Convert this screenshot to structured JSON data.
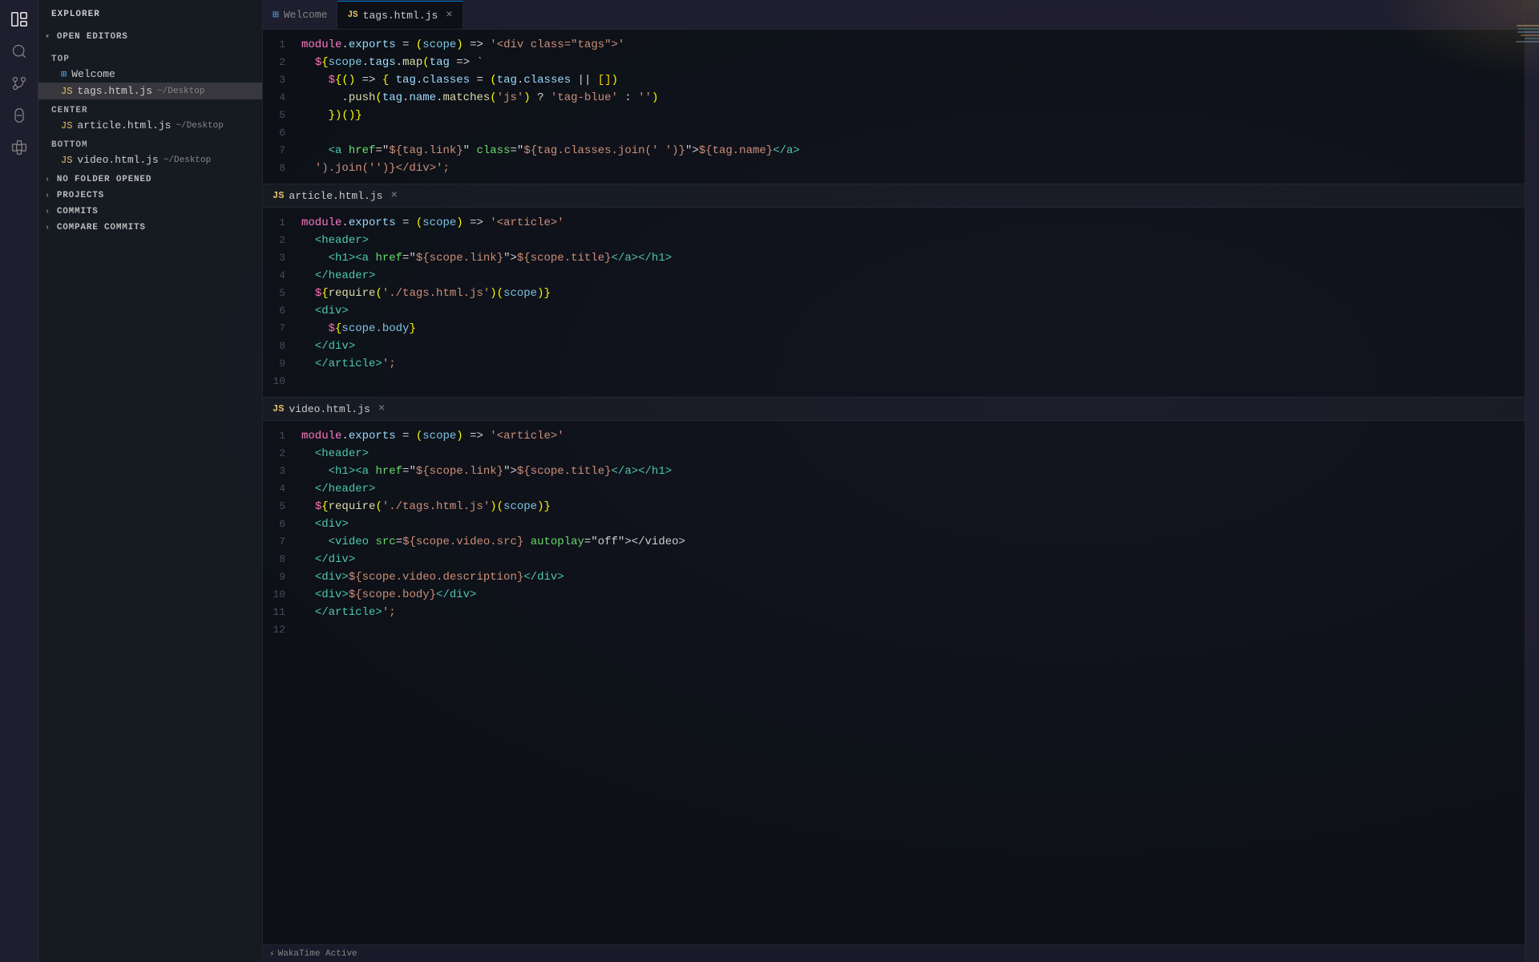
{
  "sidebar": {
    "title": "EXPLORER",
    "sections": {
      "open_editors": {
        "label": "OPEN EDITORS",
        "top_label": "TOP",
        "center_label": "CENTER",
        "bottom_label": "BOTTOM",
        "top_files": [
          {
            "name": "Welcome",
            "type": "welcome",
            "path": ""
          },
          {
            "name": "tags.html.js",
            "type": "js",
            "path": "~/Desktop",
            "active": true
          }
        ],
        "center_files": [
          {
            "name": "article.html.js",
            "type": "js",
            "path": "~/Desktop"
          }
        ],
        "bottom_files": [
          {
            "name": "video.html.js",
            "type": "js",
            "path": "~/Desktop"
          }
        ]
      },
      "no_folder": "NO FOLDER OPENED",
      "projects": "PROJECTS",
      "commits": "COMMITS",
      "compare_commits": "COMPARE COMMITS"
    }
  },
  "tabs": [
    {
      "name": "Welcome",
      "type": "welcome",
      "active": false
    },
    {
      "name": "tags.html.js",
      "type": "js",
      "active": true,
      "closable": true
    }
  ],
  "editors": [
    {
      "filename": "tags.html.js",
      "type": "js",
      "closable": true,
      "lines": [
        {
          "num": 1,
          "tokens": [
            {
              "t": "keyword",
              "v": "module"
            },
            {
              "t": "white",
              "v": "."
            },
            {
              "t": "prop",
              "v": "exports"
            },
            {
              "t": "white",
              "v": " = "
            },
            {
              "t": "paren",
              "v": "("
            },
            {
              "t": "scope",
              "v": "scope"
            },
            {
              "t": "paren",
              "v": ")"
            },
            {
              "t": "white",
              "v": " => "
            },
            {
              "t": "string",
              "v": "'<div class=\"tags\">'"
            }
          ]
        },
        {
          "num": 2,
          "tokens": [
            {
              "t": "white",
              "v": "  "
            },
            {
              "t": "dollar",
              "v": "$"
            },
            {
              "t": "paren",
              "v": "{"
            },
            {
              "t": "scope",
              "v": "scope"
            },
            {
              "t": "white",
              "v": "."
            },
            {
              "t": "prop",
              "v": "tags"
            },
            {
              "t": "white",
              "v": "."
            },
            {
              "t": "method",
              "v": "map"
            },
            {
              "t": "paren",
              "v": "("
            },
            {
              "t": "var",
              "v": "tag"
            },
            {
              "t": "white",
              "v": " => "
            },
            {
              "t": "string",
              "v": "`"
            }
          ]
        },
        {
          "num": 3,
          "tokens": [
            {
              "t": "white",
              "v": "    "
            },
            {
              "t": "dollar",
              "v": "$"
            },
            {
              "t": "paren",
              "v": "{("
            },
            {
              "t": "paren",
              "v": ")"
            },
            {
              "t": "white",
              "v": " => "
            },
            {
              "t": "paren",
              "v": "{"
            },
            {
              "t": "white",
              "v": " "
            },
            {
              "t": "var",
              "v": "tag"
            },
            {
              "t": "white",
              "v": "."
            },
            {
              "t": "prop",
              "v": "classes"
            },
            {
              "t": "white",
              "v": " = "
            },
            {
              "t": "paren",
              "v": "("
            },
            {
              "t": "var",
              "v": "tag"
            },
            {
              "t": "white",
              "v": "."
            },
            {
              "t": "prop",
              "v": "classes"
            },
            {
              "t": "white",
              "v": " || "
            },
            {
              "t": "bracket",
              "v": "[]"
            },
            {
              "t": "paren",
              "v": ")"
            }
          ]
        },
        {
          "num": 4,
          "tokens": [
            {
              "t": "white",
              "v": "      ."
            },
            {
              "t": "method",
              "v": "push"
            },
            {
              "t": "paren",
              "v": "("
            },
            {
              "t": "var",
              "v": "tag"
            },
            {
              "t": "white",
              "v": "."
            },
            {
              "t": "prop",
              "v": "name"
            },
            {
              "t": "white",
              "v": "."
            },
            {
              "t": "method",
              "v": "matches"
            },
            {
              "t": "paren",
              "v": "("
            },
            {
              "t": "string",
              "v": "'js'"
            },
            {
              "t": "paren",
              "v": ")"
            },
            {
              "t": "white",
              "v": " ? "
            },
            {
              "t": "string",
              "v": "'tag-blue'"
            },
            {
              "t": "white",
              "v": " : "
            },
            {
              "t": "string",
              "v": "''"
            },
            {
              "t": "paren",
              "v": ")"
            }
          ]
        },
        {
          "num": 5,
          "tokens": [
            {
              "t": "white",
              "v": "    "
            },
            {
              "t": "paren",
              "v": "})()"
            },
            {
              "t": "paren",
              "v": "}"
            }
          ]
        },
        {
          "num": 6,
          "tokens": []
        },
        {
          "num": 7,
          "tokens": [
            {
              "t": "white",
              "v": "    "
            },
            {
              "t": "tag",
              "v": "<a"
            },
            {
              "t": "white",
              "v": " "
            },
            {
              "t": "attr",
              "v": "href"
            },
            {
              "t": "white",
              "v": "="
            },
            {
              "t": "string",
              "v": "\"${tag.link}\""
            },
            {
              "t": "white",
              "v": " "
            },
            {
              "t": "attr",
              "v": "class"
            },
            {
              "t": "white",
              "v": "="
            },
            {
              "t": "string",
              "v": "\"${tag.classes.join(' ')}\""
            },
            {
              "t": "template",
              "v": ">${tag.name}</a>"
            }
          ]
        },
        {
          "num": 8,
          "tokens": [
            {
              "t": "white",
              "v": "  "
            },
            {
              "t": "string",
              "v": "').join('')}</div>';"
            }
          ]
        }
      ]
    },
    {
      "filename": "article.html.js",
      "type": "js",
      "closable": true,
      "lines": [
        {
          "num": 1,
          "tokens": [
            {
              "t": "keyword",
              "v": "module"
            },
            {
              "t": "white",
              "v": "."
            },
            {
              "t": "prop",
              "v": "exports"
            },
            {
              "t": "white",
              "v": " = "
            },
            {
              "t": "paren",
              "v": "("
            },
            {
              "t": "scope",
              "v": "scope"
            },
            {
              "t": "paren",
              "v": ")"
            },
            {
              "t": "white",
              "v": " => "
            },
            {
              "t": "string",
              "v": "'<article>'"
            }
          ]
        },
        {
          "num": 2,
          "tokens": [
            {
              "t": "white",
              "v": "  "
            },
            {
              "t": "tag",
              "v": "<header>"
            }
          ]
        },
        {
          "num": 3,
          "tokens": [
            {
              "t": "white",
              "v": "    "
            },
            {
              "t": "tag",
              "v": "<h1>"
            },
            {
              "t": "tag",
              "v": "<a"
            },
            {
              "t": "white",
              "v": " "
            },
            {
              "t": "attr",
              "v": "href"
            },
            {
              "t": "white",
              "v": "="
            },
            {
              "t": "string",
              "v": "\"${scope.link}\""
            },
            {
              "t": "tag",
              "v": ">"
            },
            {
              "t": "template",
              "v": "${scope.title}"
            },
            {
              "t": "tag",
              "v": "</a></h1>"
            }
          ]
        },
        {
          "num": 4,
          "tokens": [
            {
              "t": "white",
              "v": "  "
            },
            {
              "t": "tag",
              "v": "</header>"
            }
          ]
        },
        {
          "num": 5,
          "tokens": [
            {
              "t": "white",
              "v": "  "
            },
            {
              "t": "dollar",
              "v": "$"
            },
            {
              "t": "paren",
              "v": "{"
            },
            {
              "t": "method",
              "v": "require"
            },
            {
              "t": "paren",
              "v": "("
            },
            {
              "t": "string",
              "v": "'./tags.html.js'"
            },
            {
              "t": "paren",
              "v": ")"
            },
            {
              "t": "paren",
              "v": "("
            },
            {
              "t": "scope",
              "v": "scope"
            },
            {
              "t": "paren",
              "v": ")}"
            }
          ]
        },
        {
          "num": 6,
          "tokens": [
            {
              "t": "white",
              "v": "  "
            },
            {
              "t": "tag",
              "v": "<div>"
            }
          ]
        },
        {
          "num": 7,
          "tokens": [
            {
              "t": "white",
              "v": "    "
            },
            {
              "t": "dollar",
              "v": "$"
            },
            {
              "t": "paren",
              "v": "{"
            },
            {
              "t": "prop",
              "v": "scope.body"
            },
            {
              "t": "paren",
              "v": "}"
            }
          ]
        },
        {
          "num": 8,
          "tokens": [
            {
              "t": "white",
              "v": "  "
            },
            {
              "t": "tag",
              "v": "</div>"
            }
          ]
        },
        {
          "num": 9,
          "tokens": [
            {
              "t": "white",
              "v": "  "
            },
            {
              "t": "tag",
              "v": "</article>"
            },
            {
              "t": "string",
              "v": "';"
            }
          ]
        },
        {
          "num": 10,
          "tokens": []
        }
      ]
    },
    {
      "filename": "video.html.js",
      "type": "js",
      "closable": true,
      "lines": [
        {
          "num": 1,
          "tokens": [
            {
              "t": "keyword",
              "v": "module"
            },
            {
              "t": "white",
              "v": "."
            },
            {
              "t": "prop",
              "v": "exports"
            },
            {
              "t": "white",
              "v": " = "
            },
            {
              "t": "paren",
              "v": "("
            },
            {
              "t": "scope",
              "v": "scope"
            },
            {
              "t": "paren",
              "v": ")"
            },
            {
              "t": "white",
              "v": " => "
            },
            {
              "t": "string",
              "v": "'<article>'"
            }
          ]
        },
        {
          "num": 2,
          "tokens": [
            {
              "t": "white",
              "v": "  "
            },
            {
              "t": "tag",
              "v": "<header>"
            }
          ]
        },
        {
          "num": 3,
          "tokens": [
            {
              "t": "white",
              "v": "    "
            },
            {
              "t": "tag",
              "v": "<h1>"
            },
            {
              "t": "tag",
              "v": "<a"
            },
            {
              "t": "white",
              "v": " "
            },
            {
              "t": "attr",
              "v": "href"
            },
            {
              "t": "white",
              "v": "="
            },
            {
              "t": "string",
              "v": "\"${scope.link}\""
            },
            {
              "t": "tag",
              "v": ">"
            },
            {
              "t": "template",
              "v": "${scope.title}"
            },
            {
              "t": "tag",
              "v": "</a></h1>"
            }
          ]
        },
        {
          "num": 4,
          "tokens": [
            {
              "t": "white",
              "v": "  "
            },
            {
              "t": "tag",
              "v": "</header>"
            }
          ]
        },
        {
          "num": 5,
          "tokens": [
            {
              "t": "white",
              "v": "  "
            },
            {
              "t": "dollar",
              "v": "$"
            },
            {
              "t": "paren",
              "v": "{"
            },
            {
              "t": "method",
              "v": "require"
            },
            {
              "t": "paren",
              "v": "("
            },
            {
              "t": "string",
              "v": "'./tags.html.js'"
            },
            {
              "t": "paren",
              "v": ")"
            },
            {
              "t": "paren",
              "v": "("
            },
            {
              "t": "scope",
              "v": "scope"
            },
            {
              "t": "paren",
              "v": ")}"
            }
          ]
        },
        {
          "num": 6,
          "tokens": [
            {
              "t": "white",
              "v": "  "
            },
            {
              "t": "tag",
              "v": "<div>"
            }
          ]
        },
        {
          "num": 7,
          "tokens": [
            {
              "t": "white",
              "v": "    "
            },
            {
              "t": "tag",
              "v": "<video"
            },
            {
              "t": "white",
              "v": " "
            },
            {
              "t": "attr",
              "v": "src"
            },
            {
              "t": "white",
              "v": "="
            },
            {
              "t": "template",
              "v": "${scope.video.src}"
            }
          ]
        },
        {
          "num": 8,
          "tokens": [
            {
              "t": "white",
              "v": "  "
            },
            {
              "t": "tag",
              "v": "</div>"
            }
          ]
        },
        {
          "num": 9,
          "tokens": [
            {
              "t": "white",
              "v": "  "
            },
            {
              "t": "tag",
              "v": "<div>"
            },
            {
              "t": "template",
              "v": "${scope.video.description}"
            },
            {
              "t": "tag",
              "v": "</div>"
            }
          ]
        },
        {
          "num": 10,
          "tokens": [
            {
              "t": "white",
              "v": "  "
            },
            {
              "t": "tag",
              "v": "<div>"
            },
            {
              "t": "template",
              "v": "${scope.body}"
            },
            {
              "t": "tag",
              "v": "</div>"
            }
          ]
        },
        {
          "num": 11,
          "tokens": [
            {
              "t": "white",
              "v": "  "
            },
            {
              "t": "tag",
              "v": "</article>"
            },
            {
              "t": "string",
              "v": "';"
            }
          ]
        },
        {
          "num": 12,
          "tokens": []
        }
      ]
    }
  ],
  "status_bar": {
    "icon": "⚡",
    "wakatime_label": "WakaTime Active"
  }
}
